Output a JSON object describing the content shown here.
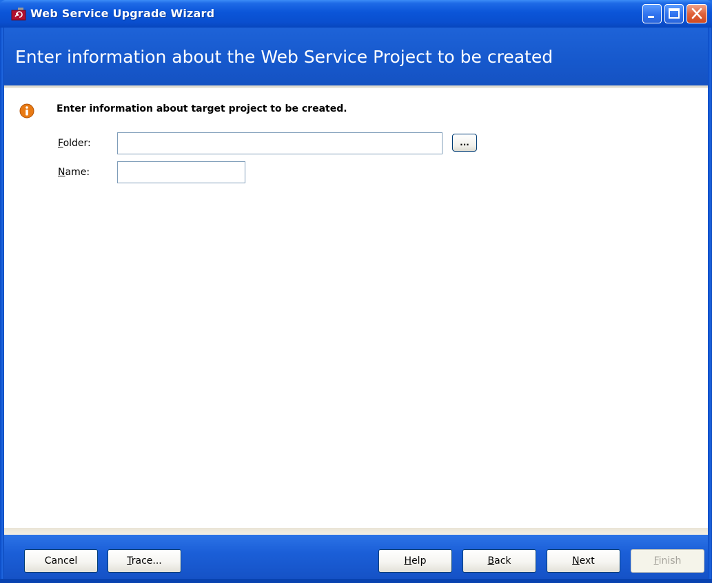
{
  "window": {
    "title": "Web Service Upgrade Wizard",
    "controls": {
      "minimize": "minimize-icon",
      "maximize": "maximize-icon",
      "close": "close-icon"
    }
  },
  "header": {
    "title": "Enter information about the Web Service Project to be created"
  },
  "content": {
    "info_icon": "info-icon",
    "message": "Enter information about target project to be created.",
    "fields": {
      "folder": {
        "label_accel": "F",
        "label_rest": "older:",
        "value": "",
        "browse_label": "..."
      },
      "name": {
        "label_accel": "N",
        "label_rest": "ame:",
        "value": ""
      }
    }
  },
  "footer": {
    "cancel": "Cancel",
    "trace_accel": "T",
    "trace_rest": "race...",
    "help_accel": "H",
    "help_rest": "elp",
    "back_accel": "B",
    "back_rest": "ack",
    "next_accel": "N",
    "next_rest": "ext",
    "finish_accel": "F",
    "finish_rest": "inish"
  },
  "colors": {
    "titlebar": "#0b55d8",
    "header_band": "#1658cc",
    "close_button": "#e0623a",
    "info_icon": "#e87a14",
    "input_border": "#7f9db9"
  }
}
